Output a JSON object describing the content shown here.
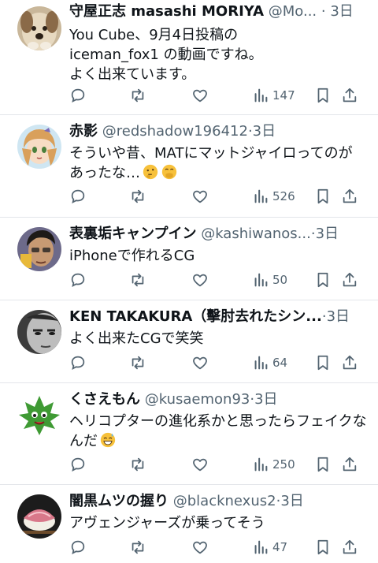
{
  "tweets": [
    {
      "name": "守屋正志 masashi MORIYA",
      "handle": "@Mo...",
      "dot": "·",
      "time": "3日",
      "lines": [
        "You Cube、9月4日投稿の",
        "iceman_fox1 の動画ですね。",
        "よく出来ています。"
      ],
      "views": "147",
      "avatar": "dog-avatar"
    },
    {
      "name": "赤影",
      "handle": "@redshadow196412",
      "dot": "·",
      "time": "3日",
      "lines": [
        "そういや昔、MATにマットジャイロってのが",
        "あったな…"
      ],
      "emoji": [
        "thinking-face-icon",
        "hand-over-mouth-icon"
      ],
      "views": "526",
      "avatar": "anime-girl-avatar"
    },
    {
      "name": "表裏垢キャンプイン",
      "handle": "@kashiwanos...",
      "dot": "·",
      "time": "3日",
      "lines": [
        "iPhoneで作れるCG"
      ],
      "views": "50",
      "avatar": "man-photo-avatar"
    },
    {
      "name": "KEN TAKAKURA（擊肘去れたシン...",
      "handle": "",
      "dot": "·",
      "time": "3日",
      "lines": [
        "よく出来たCGで笑笑"
      ],
      "views": "64",
      "avatar": "bw-face-avatar"
    },
    {
      "name": "くさえもん",
      "handle": "@kusaemon93",
      "dot": "·",
      "time": "3日",
      "lines": [
        "ヘリコプターの進化系かと思ったらフェイクな",
        "んだ"
      ],
      "emoji": [
        "grinning-sweat-icon"
      ],
      "views": "250",
      "avatar": "leaf-character-avatar"
    },
    {
      "name": "闇黒ムツの握り",
      "handle": "@blacknexus2",
      "dot": "·",
      "time": "3日",
      "lines": [
        "アヴェンジャーズが乗ってそう"
      ],
      "views": "47",
      "avatar": "sushi-avatar"
    }
  ],
  "colors": {
    "text": "#0f1419",
    "muted": "#536471",
    "divider": "#e3e6ea"
  }
}
